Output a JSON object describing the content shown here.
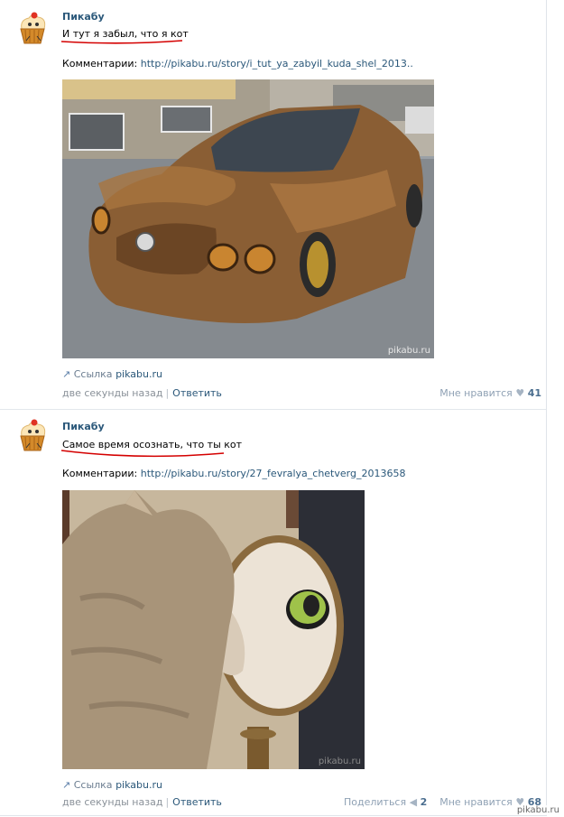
{
  "posts": [
    {
      "author": "Пикабу",
      "text": "И тут я забыл, что я кот",
      "comments_label": "Комментарии:",
      "comments_url": "http://pikabu.ru/story/i_tut_ya_zabyil_kuda_shel_2013..",
      "link_label": "Ссылка",
      "link_domain": "pikabu.ru",
      "time": "две секунды назад",
      "reply": "Ответить",
      "likes_label": "Мне нравится",
      "likes_count": "41",
      "image_watermark": "pikabu.ru"
    },
    {
      "author": "Пикабу",
      "text": "Самое время осознать, что ты кот",
      "comments_label": "Комментарии:",
      "comments_url": "http://pikabu.ru/story/27_fevralya_chetverg_2013658",
      "link_label": "Ссылка",
      "link_domain": "pikabu.ru",
      "time": "две секунды назад",
      "reply": "Ответить",
      "share_label": "Поделиться",
      "share_count": "2",
      "likes_label": "Мне нравится",
      "likes_count": "68",
      "image_watermark": "pikabu.ru"
    }
  ],
  "watermark": "pikabu.ru",
  "colors": {
    "link": "#2b587a",
    "muted": "#8a9199",
    "underline": "#d40000"
  }
}
